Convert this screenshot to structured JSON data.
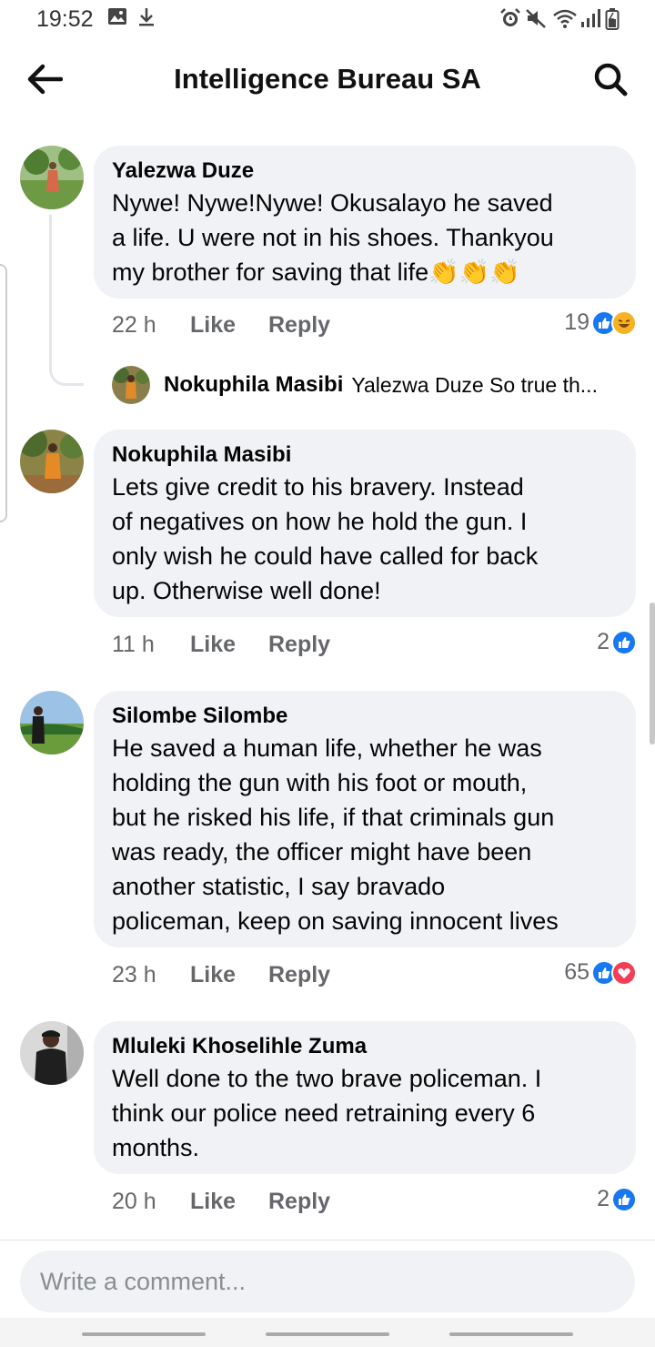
{
  "status_bar": {
    "time": "19:52",
    "icons": [
      "image-icon",
      "download-icon",
      "alarm-icon",
      "mute-icon",
      "wifi-icon",
      "signal-icon",
      "battery-icon"
    ]
  },
  "header": {
    "title": "Intelligence Bureau SA",
    "back_icon": "back-arrow-icon",
    "search_icon": "search-icon"
  },
  "comments": [
    {
      "author": "Yalezwa Duze",
      "text_lines": [
        "Nywe! Nywe!Nywe! Okusalayo he saved",
        "a life. U were not in his shoes. Thankyou",
        "my brother for saving that life👏👏👏"
      ],
      "time": "22 h",
      "like_label": "Like",
      "reply_label": "Reply",
      "reaction_count": "19",
      "reactions": [
        "like",
        "haha"
      ]
    },
    {
      "author": "Nokuphila Masibi",
      "text_lines": [
        "Lets give credit to his bravery.  Instead",
        "of negatives on how he hold  the gun. I",
        "only wish he could have called for back",
        "up. Otherwise well done!"
      ],
      "time": "11 h",
      "like_label": "Like",
      "reply_label": "Reply",
      "reaction_count": "2",
      "reactions": [
        "like"
      ]
    },
    {
      "author": "Silombe Silombe",
      "text_lines": [
        "He saved a human life, whether  he was",
        "holding the gun with his foot or mouth,",
        "but he risked his life, if that criminals gun",
        "was ready, the officer might have been",
        "another statistic, I say bravado",
        "policeman, keep on saving innocent lives"
      ],
      "time": "23 h",
      "like_label": "Like",
      "reply_label": "Reply",
      "reaction_count": "65",
      "reactions": [
        "like",
        "love"
      ]
    },
    {
      "author": "Mluleki Khoselihle Zuma",
      "text_lines": [
        "Well done to the two brave policeman. I",
        "think our police need retraining every 6",
        "months."
      ],
      "time": "20 h",
      "like_label": "Like",
      "reply_label": "Reply",
      "reaction_count": "2",
      "reactions": [
        "like"
      ]
    }
  ],
  "reply_preview": {
    "author": "Nokuphila Masibi",
    "text": "Yalezwa Duze  So true th..."
  },
  "composer": {
    "placeholder": "Write a comment..."
  },
  "colors": {
    "bubble": "#f0f2f5",
    "meta_text": "#65676b",
    "like_blue": "#1877f2",
    "love_red": "#f33e58",
    "haha_yellow": "#f7b125"
  }
}
